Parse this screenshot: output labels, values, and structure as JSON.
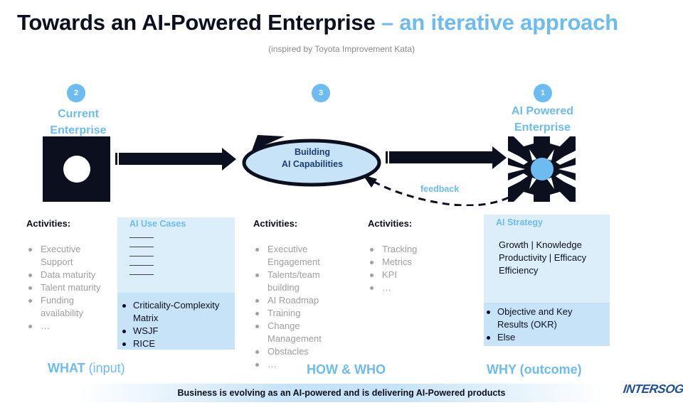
{
  "title": {
    "main": "Towards an AI-Powered Enterprise",
    "accent": " – an iterative approach"
  },
  "subtitle": "(inspired by Toyota Improvement Kata)",
  "colors": {
    "accent": "#6cbcf2",
    "dark": "#0b0f1e",
    "box_light": "#ddeefb",
    "box_mid": "#c6e3f8",
    "logo": "#1f4e9c"
  },
  "nodes": [
    {
      "step": "2",
      "label_line1": "Current",
      "label_line2": "Enterprise",
      "icon": "square-with-circle-icon"
    },
    {
      "step": "3",
      "label_line1": "Building",
      "label_line2": "AI Capabilities",
      "icon": "cycle-ellipse-icon"
    },
    {
      "step": "1",
      "label_line1": "AI Powered",
      "label_line2": "Enterprise",
      "icon": "converging-arrows-icon"
    }
  ],
  "feedback_label": "feedback",
  "what_activities": {
    "header": "Activities:",
    "items": [
      "Executive Support",
      "Data maturity",
      "Talent maturity",
      "Funding availability",
      "…"
    ]
  },
  "use_cases": {
    "title": "AI Use Cases",
    "placeholder_lines": 5,
    "items": [
      "Criticality-Complexity Matrix",
      "WSJF",
      "RICE"
    ]
  },
  "how_activities": {
    "header": "Activities:",
    "items": [
      "Executive Engagement",
      "Talents/team building",
      "AI Roadmap",
      "Training",
      "Change Management",
      "Obstacles",
      "…"
    ]
  },
  "measure_activities": {
    "header": "Activities:",
    "items": [
      "Tracking",
      "Metrics",
      "KPI",
      "…"
    ]
  },
  "strategy": {
    "title": "AI Strategy",
    "lines": [
      "Growth | Knowledge",
      "Productivity | Efficacy",
      "Efficiency"
    ],
    "items": [
      "Objective and Key Results (OKR)",
      "Else"
    ]
  },
  "sections": {
    "what_bold": "WHAT",
    "what_rest": " (input)",
    "how": "HOW & WHO",
    "why": "WHY (outcome)"
  },
  "banner": "Business is evolving as an AI-powered and is delivering AI-Powered products",
  "logo": "INTERSOG"
}
